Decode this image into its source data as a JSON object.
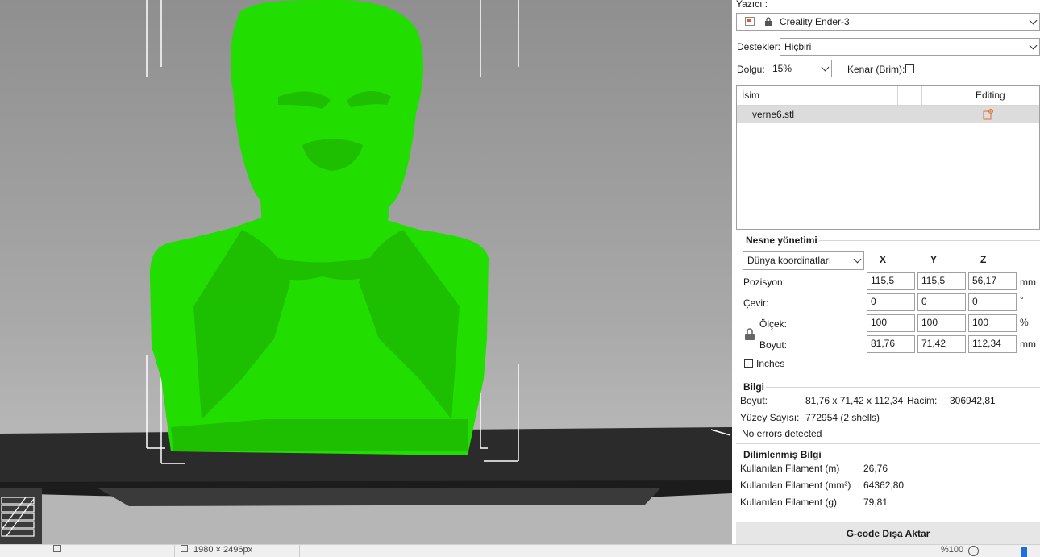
{
  "printer": {
    "label": "Yazıcı :",
    "selected": "Creality Ender-3"
  },
  "supports": {
    "label": "Destekler:",
    "selected": "Hiçbiri"
  },
  "infill": {
    "label": "Dolgu:",
    "selected": "15%"
  },
  "brim": {
    "label": "Kenar (Brim):"
  },
  "object_list": {
    "col_name": "İsim",
    "col_editing": "Editing",
    "rows": [
      {
        "name": "verne6.stl"
      }
    ]
  },
  "manipulation": {
    "title": "Nesne yönetimi",
    "coord_system": "Dünya koordinatları",
    "axes": [
      "X",
      "Y",
      "Z"
    ],
    "position": {
      "label": "Pozisyon:",
      "x": "115,5",
      "y": "115,5",
      "z": "56,17",
      "unit": "mm"
    },
    "rotation": {
      "label": "Çevir:",
      "x": "0",
      "y": "0",
      "z": "0",
      "unit": "°"
    },
    "scale": {
      "label": "Ölçek:",
      "x": "100",
      "y": "100",
      "z": "100",
      "unit": "%"
    },
    "size": {
      "label": "Boyut:",
      "x": "81,76",
      "y": "71,42",
      "z": "112,34",
      "unit": "mm"
    },
    "inches_label": "Inches"
  },
  "info": {
    "title": "Bilgi",
    "size_label": "Boyut:",
    "size_value": "81,76 x 71,42 x 112,34",
    "volume_label": "Hacim:",
    "volume_value": "306942,81",
    "facets_label": "Yüzey Sayısı:",
    "facets_value": "772954 (2 shells)",
    "errors": "No errors detected"
  },
  "sliced_info": {
    "title": "Dilimlenmiş Bilgi",
    "rows": [
      {
        "label": "Kullanılan Filament (m)",
        "value": "26,76"
      },
      {
        "label": "Kullanılan Filament (mm³)",
        "value": "64362,80"
      },
      {
        "label": "Kullanılan Filament (g)",
        "value": "79,81"
      }
    ]
  },
  "export_button": "G-code Dışa Aktar",
  "status_bar": {
    "dimensions": "1980 × 2496px",
    "zoom": "%100"
  },
  "colors": {
    "model": "#22dd00",
    "bed": "#2b2b2b",
    "background": "#a9a9a9"
  }
}
